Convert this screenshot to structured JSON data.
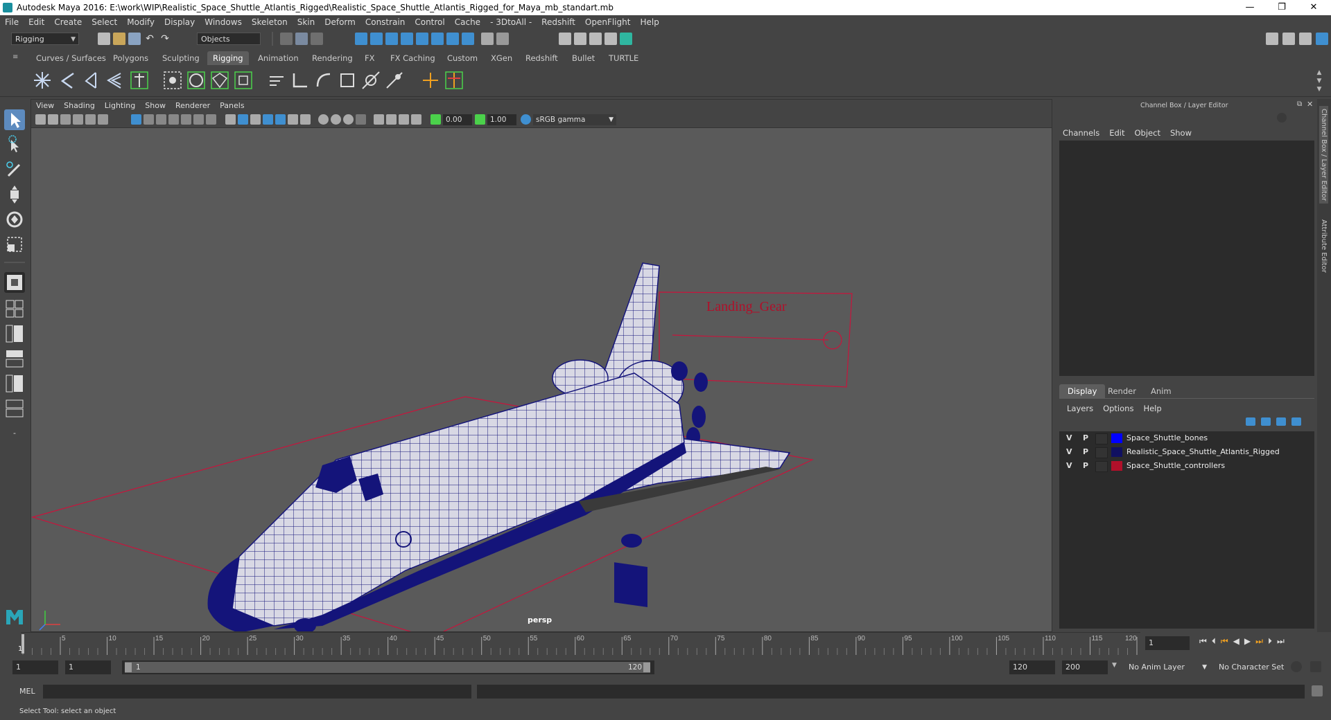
{
  "window": {
    "title": "Autodesk Maya 2016: E:\\work\\WIP\\Realistic_Space_Shuttle_Atlantis_Rigged\\Realistic_Space_Shuttle_Atlantis_Rigged_for_Maya_mb_standart.mb",
    "minimize": "—",
    "restore": "❐",
    "close": "✕"
  },
  "menubar": [
    "File",
    "Edit",
    "Create",
    "Select",
    "Modify",
    "Display",
    "Windows",
    "Skeleton",
    "Skin",
    "Deform",
    "Constrain",
    "Control",
    "Cache",
    "- 3DtoAll -",
    "Redshift",
    "OpenFlight",
    "Help"
  ],
  "statusline": {
    "mode": "Rigging",
    "selection_mode": "Objects"
  },
  "shelf_tabs": [
    {
      "label": "Curves / Surfaces",
      "active": false
    },
    {
      "label": "Polygons",
      "active": false
    },
    {
      "label": "Sculpting",
      "active": false
    },
    {
      "label": "Rigging",
      "active": true
    },
    {
      "label": "Animation",
      "active": false
    },
    {
      "label": "Rendering",
      "active": false
    },
    {
      "label": "FX",
      "active": false
    },
    {
      "label": "FX Caching",
      "active": false
    },
    {
      "label": "Custom",
      "active": false
    },
    {
      "label": "XGen",
      "active": false
    },
    {
      "label": "Redshift",
      "active": false
    },
    {
      "label": "Bullet",
      "active": false
    },
    {
      "label": "TURTLE",
      "active": false
    }
  ],
  "viewport": {
    "menu": [
      "View",
      "Shading",
      "Lighting",
      "Show",
      "Renderer",
      "Panels"
    ],
    "near_value": "0.00",
    "gamma_value": "1.00",
    "color_space": "sRGB gamma",
    "camera_label": "persp",
    "annotation": "Landing_Gear",
    "colors": {
      "background": "#5a5a5a",
      "wire": "#14147a",
      "controller": "#c8143c"
    }
  },
  "channel_box": {
    "title": "Channel Box / Layer Editor",
    "menu": [
      "Channels",
      "Edit",
      "Object",
      "Show"
    ],
    "layer_tabs": [
      {
        "label": "Display",
        "active": true
      },
      {
        "label": "Render",
        "active": false
      },
      {
        "label": "Anim",
        "active": false
      }
    ],
    "layer_menu": [
      "Layers",
      "Options",
      "Help"
    ],
    "layers": [
      {
        "v": "V",
        "p": "P",
        "color": "#0000ff",
        "name": "Space_Shuttle_bones"
      },
      {
        "v": "V",
        "p": "P",
        "color": "#101060",
        "name": "Realistic_Space_Shuttle_Atlantis_Rigged"
      },
      {
        "v": "V",
        "p": "P",
        "color": "#b0102a",
        "name": "Space_Shuttle_controllers"
      }
    ]
  },
  "side_tabs": [
    "Channel Box / Layer Editor",
    "Attribute Editor"
  ],
  "time_slider": {
    "ticks": [
      "5",
      "10",
      "15",
      "20",
      "25",
      "30",
      "35",
      "40",
      "45",
      "50",
      "55",
      "60",
      "65",
      "70",
      "75",
      "80",
      "85",
      "90",
      "95",
      "100",
      "105",
      "110",
      "115",
      "120"
    ],
    "start_label": "1",
    "current_frame": "1"
  },
  "range_slider": {
    "start": "1",
    "playback_start": "1",
    "range_start_label": "1",
    "range_end_label": "120",
    "playback_end": "120",
    "end": "200",
    "anim_layer": "No Anim Layer",
    "character_set": "No Character Set"
  },
  "command_line": {
    "label": "MEL"
  },
  "help_line": "Select Tool: select an object"
}
